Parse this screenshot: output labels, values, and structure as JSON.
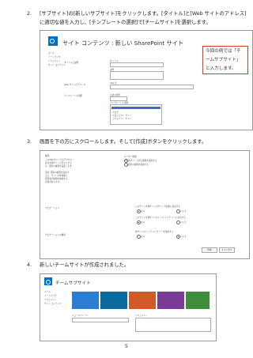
{
  "steps": [
    {
      "num": "2.",
      "text": "[サブサイト]の[新しいサブサイト]をクリックします。[タイトル]と[Web サイトのアドレス]に適切な値を入力し、[テンプレートの選択]で[チームサイト]を選択します。"
    },
    {
      "num": "3.",
      "text": "画面を下の方にスクロールします。そして[作成]ボタンをクリックします。"
    },
    {
      "num": "4.",
      "text": "新しいチームサイトが作成されました。"
    }
  ],
  "shot1": {
    "title": "サイト コンテンツ : 新しい SharePoint サイト",
    "callout": "今回の例では「チームサブサイト」と入力します。"
  },
  "shot3": {
    "title": "チームサブサイト"
  },
  "page_number": "5",
  "colors": {
    "callout_border": "#d93b2b",
    "brand": "#0072c6",
    "selection": "#3b6fc4"
  }
}
